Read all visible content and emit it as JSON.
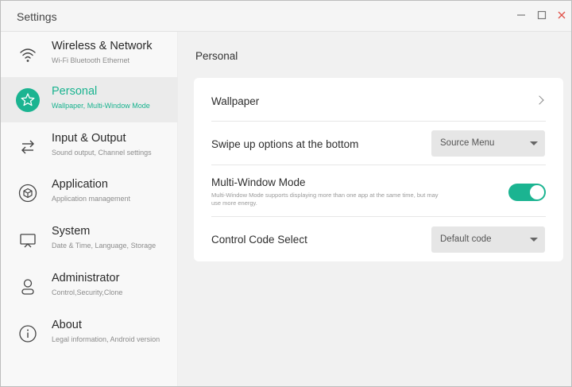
{
  "window": {
    "title": "Settings"
  },
  "sidebar": {
    "items": [
      {
        "label": "Wireless & Network",
        "sub": "Wi-Fi Bluetooth Ethernet",
        "icon": "wifi-icon",
        "active": false
      },
      {
        "label": "Personal",
        "sub": "Wallpaper, Multi-Window Mode",
        "icon": "star-icon",
        "active": true
      },
      {
        "label": "Input & Output",
        "sub": "Sound output, Channel settings",
        "icon": "swap-arrows-icon",
        "active": false
      },
      {
        "label": "Application",
        "sub": "Application management",
        "icon": "hexagon-icon",
        "active": false
      },
      {
        "label": "System",
        "sub": "Date & Time, Language, Storage",
        "icon": "monitor-icon",
        "active": false
      },
      {
        "label": "Administrator",
        "sub": "Control,Security,Clone",
        "icon": "user-icon",
        "active": false
      },
      {
        "label": "About",
        "sub": "Legal information, Android version",
        "icon": "info-icon",
        "active": false
      }
    ]
  },
  "main": {
    "heading": "Personal",
    "wallpaper_label": "Wallpaper",
    "swipe_label": "Swipe up options at the bottom",
    "swipe_value": "Source Menu",
    "multiwindow_label": "Multi-Window Mode",
    "multiwindow_desc": "Multi-Window Mode supports displaying more than one app at the same time, but may use more energy.",
    "multiwindow_enabled": true,
    "control_code_label": "Control Code Select",
    "control_code_value": "Default code"
  },
  "colors": {
    "accent": "#1bb491",
    "active_text": "#19b38f",
    "close": "#e0524a"
  }
}
